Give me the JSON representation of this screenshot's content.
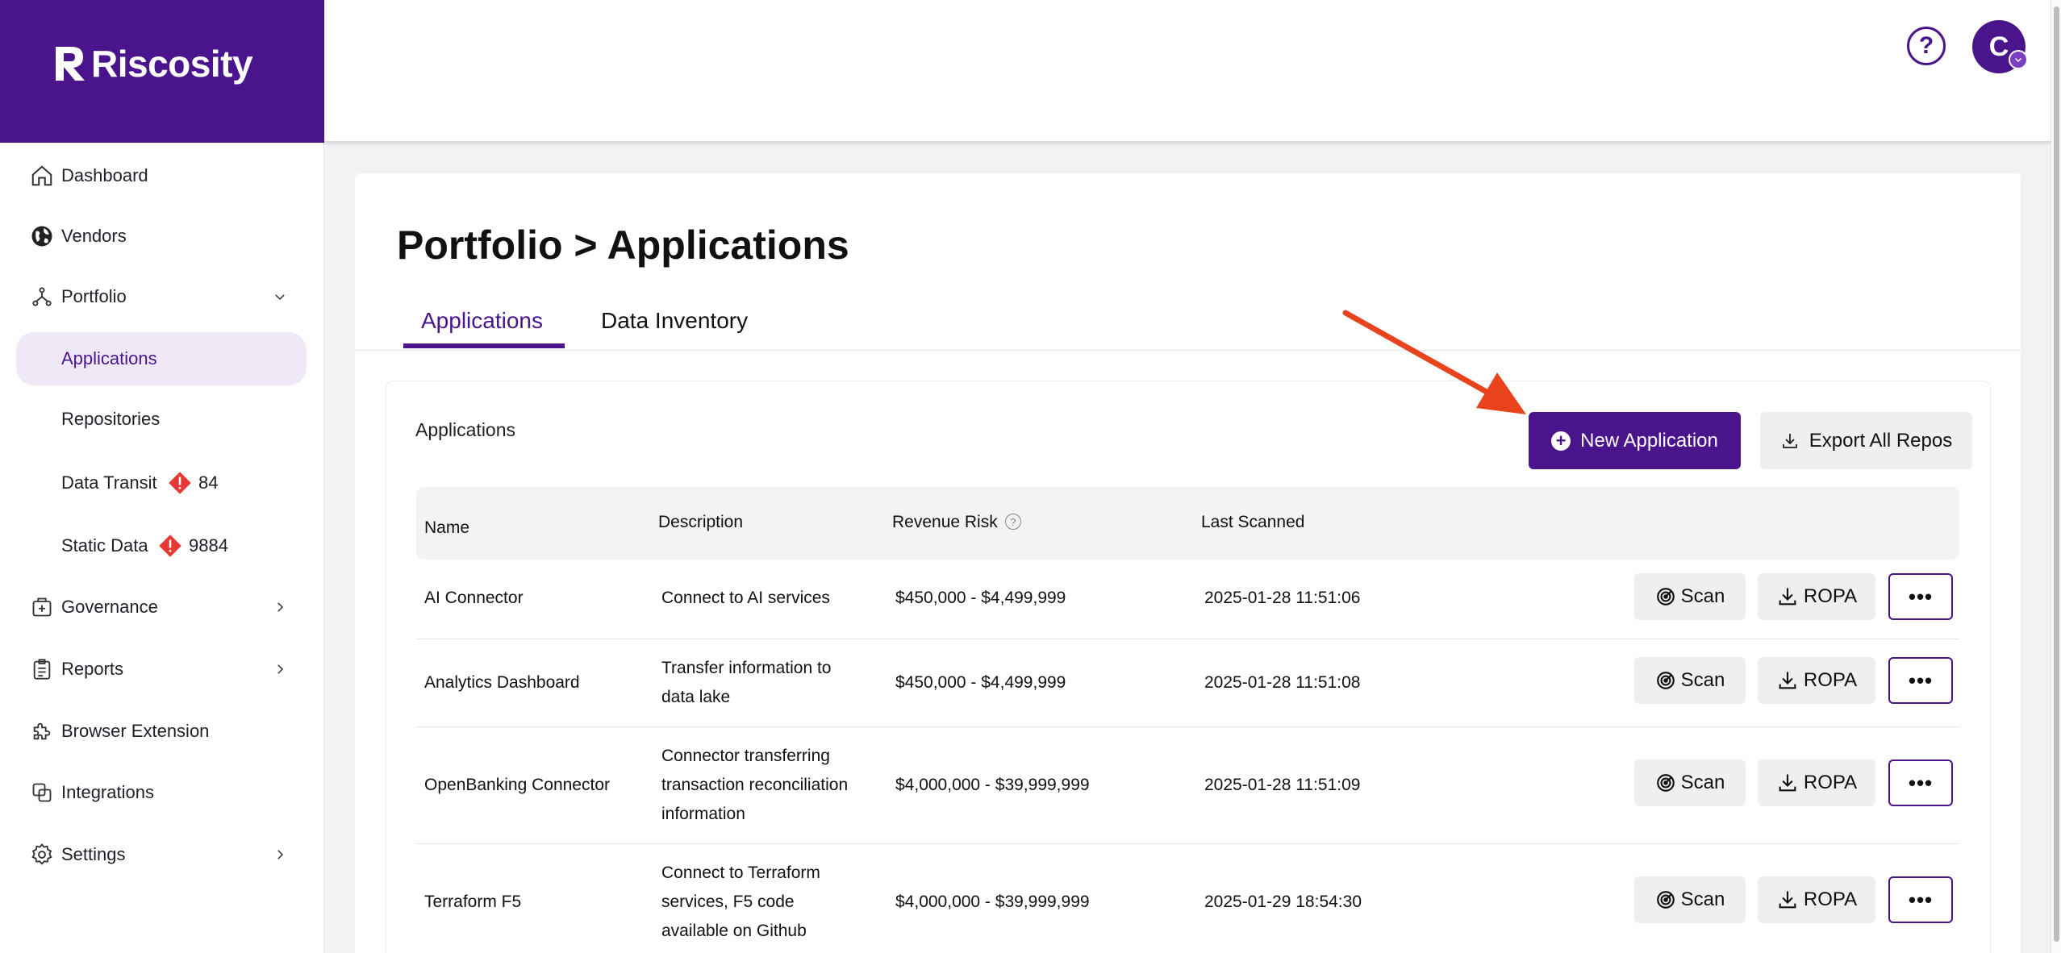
{
  "brand": {
    "name": "Riscosity"
  },
  "sidebar": {
    "items": [
      {
        "label": "Dashboard"
      },
      {
        "label": "Vendors"
      },
      {
        "label": "Portfolio"
      },
      {
        "label": "Applications"
      },
      {
        "label": "Repositories"
      },
      {
        "label": "Data Transit",
        "count": "84"
      },
      {
        "label": "Static Data",
        "count": "9884"
      },
      {
        "label": "Governance"
      },
      {
        "label": "Reports"
      },
      {
        "label": "Browser Extension"
      },
      {
        "label": "Integrations"
      },
      {
        "label": "Settings"
      }
    ]
  },
  "header": {
    "help": "?",
    "avatar_initial": "C"
  },
  "page": {
    "title": "Portfolio > Applications",
    "tabs": [
      {
        "label": "Applications"
      },
      {
        "label": "Data Inventory"
      }
    ],
    "panel_title": "Applications",
    "new_button": "New Application",
    "export_button": "Export All Repos"
  },
  "table": {
    "columns": [
      "Name",
      "Description",
      "Revenue Risk",
      "Last Scanned"
    ],
    "rows": [
      {
        "name": "AI Connector",
        "description": [
          "Connect to AI services"
        ],
        "revenue_risk": "$450,000 - $4,499,999",
        "last_scanned": "2025-01-28 11:51:06"
      },
      {
        "name": "Analytics Dashboard",
        "description": [
          "Transfer information to",
          "data lake"
        ],
        "revenue_risk": "$450,000 - $4,499,999",
        "last_scanned": "2025-01-28 11:51:08"
      },
      {
        "name": "OpenBanking Connector",
        "description": [
          "Connector transferring",
          "transaction reconciliation",
          "information"
        ],
        "revenue_risk": "$4,000,000 - $39,999,999",
        "last_scanned": "2025-01-28 11:51:09"
      },
      {
        "name": "Terraform F5",
        "description": [
          "Connect to Terraform",
          "services, F5 code",
          "available on Github"
        ],
        "revenue_risk": "$4,000,000 - $39,999,999",
        "last_scanned": "2025-01-29 18:54:30"
      }
    ],
    "actions": {
      "scan": "Scan",
      "ropa": "ROPA",
      "more": "•••"
    }
  },
  "colors": {
    "brand": "#4a148c",
    "accent_arrow": "#e8431c",
    "warn": "#e53935"
  },
  "icons": [
    "home-icon",
    "globe-icon",
    "portfolio-icon",
    "governance-icon",
    "reports-icon",
    "extension-icon",
    "integrations-icon",
    "settings-icon",
    "chevron-down-icon",
    "chevron-right-icon",
    "warning-icon",
    "help-icon",
    "info-icon",
    "plus-circle-icon",
    "download-icon",
    "scan-icon",
    "more-icon"
  ]
}
